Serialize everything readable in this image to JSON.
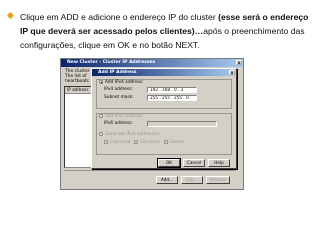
{
  "slide": {
    "text_normal_1": "Clique em ADD e adicione o endereço IP do cluster ",
    "text_bold": "(esse será o endereço IP que deverá ser acessado pelos clientes)…",
    "text_normal_2": "após o preenchimento das configurações, clique em OK e no botão NEXT."
  },
  "back_window": {
    "title": "New Cluster - Cluster IP Addresses",
    "description_lines": [
      "The cluster",
      "The list of",
      "heartbeats"
    ],
    "list_header": "IP address",
    "buttons": {
      "add": "Add...",
      "edit": "Edit...",
      "remove": "Remove"
    }
  },
  "dialog": {
    "title": "Add IP Address",
    "close_glyph": "x",
    "ipv4": {
      "radio_label": "Add IPv4 address:",
      "address_label": "IPv4 address:",
      "address_value": "192 . 168 .  0  .  3",
      "mask_label": "Subnet mask:",
      "mask_value": "255 . 255 . 255 .  0"
    },
    "ipv6": {
      "radio_label": "Add IPv6 address:",
      "address_label": "IPv6 address:",
      "auto_label": "Generate IPv6 addresses:",
      "link_local_label": "Link-local",
      "site_local_label": "Site-local",
      "global_label": "Global"
    },
    "buttons": {
      "ok": "OK",
      "cancel": "Cancel",
      "help": "Help"
    }
  },
  "colors": {
    "bullet": "#e3a21a",
    "titlebar": "#0a246a",
    "window_face": "#d4d0c8"
  }
}
